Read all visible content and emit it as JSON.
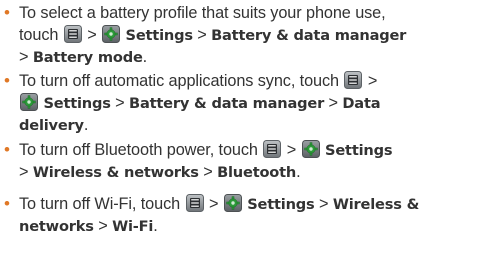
{
  "bullets": [
    {
      "lines": [
        [
          "To select a battery profile that suits your phone use,"
        ],
        [
          "touch",
          ">",
          "Settings",
          ">",
          "Battery & data manager"
        ],
        [
          ">",
          "Battery mode",
          "."
        ]
      ]
    },
    {
      "lines": [
        [
          "To turn off automatic applications sync, touch",
          ">"
        ],
        [
          "Settings",
          ">",
          "Battery & data manager",
          ">",
          "Data"
        ],
        [
          "delivery",
          "."
        ]
      ]
    },
    {
      "lines": [
        [
          "To turn off Bluetooth power, touch",
          ">",
          "Settings"
        ],
        [
          ">",
          "Wireless & networks",
          ">",
          "Bluetooth",
          "."
        ]
      ]
    },
    {
      "lines": [
        [
          "To turn off Wi-Fi, touch",
          ">",
          "Settings",
          ">",
          "Wireless &"
        ],
        [
          "networks",
          ">",
          "Wi-Fi",
          "."
        ]
      ]
    }
  ],
  "icons": {
    "menu": "menu-key-icon",
    "settings": "settings-gear-icon"
  },
  "colors": {
    "bullet": "#e07826",
    "text": "#333333"
  }
}
